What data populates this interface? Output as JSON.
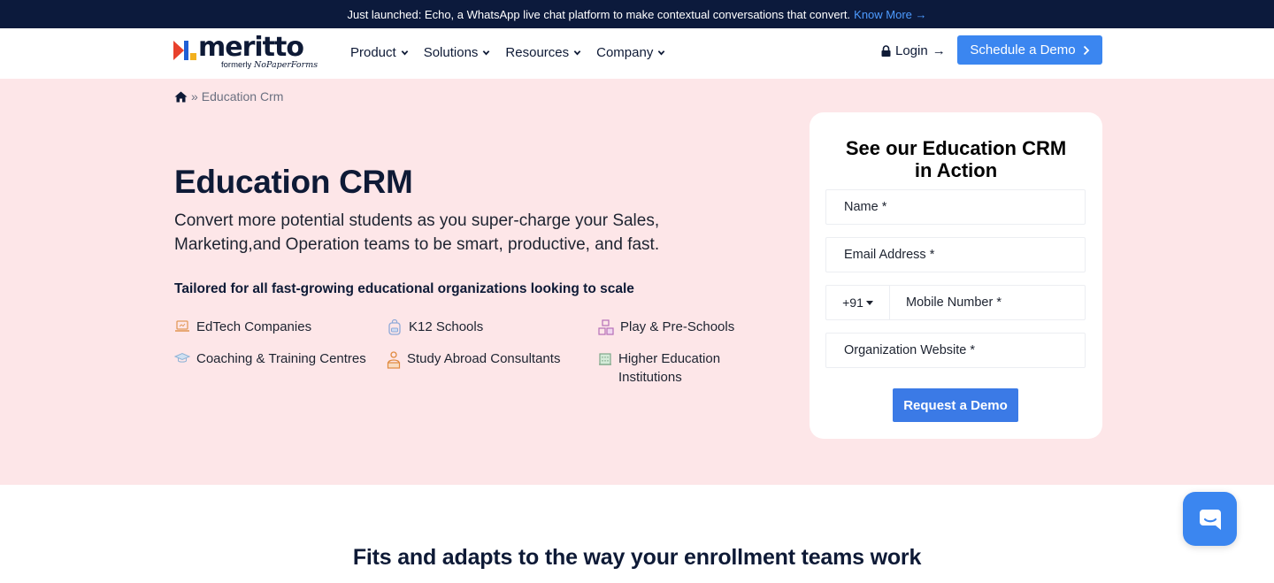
{
  "announcement": {
    "text": "Just launched: Echo, a WhatsApp live chat platform to make contextual conversations that convert.",
    "link_label": "Know More",
    "link_arrow": "→"
  },
  "header": {
    "logo_text": "meritto",
    "logo_sub_prefix": "formerly",
    "logo_sub_brand": "NoPaperForms",
    "nav": [
      {
        "label": "Product"
      },
      {
        "label": "Solutions"
      },
      {
        "label": "Resources"
      },
      {
        "label": "Company"
      }
    ],
    "login_label": "Login",
    "login_arrow": "→",
    "demo_label": "Schedule a Demo",
    "demo_arrow": "›"
  },
  "breadcrumb": {
    "separator": "»",
    "current": "Education Crm"
  },
  "hero": {
    "title": "Education CRM",
    "subtitle": "Convert more potential students as you super-charge your Sales, Marketing,and Operation teams to be smart, productive, and fast.",
    "tagline": "Tailored for all fast-growing educational organizations looking to scale",
    "segments": [
      {
        "label": "EdTech Companies",
        "icon": "laptop-icon"
      },
      {
        "label": "K12 Schools",
        "icon": "backpack-icon"
      },
      {
        "label": "Play & Pre-Schools",
        "icon": "blocks-icon"
      },
      {
        "label": "Coaching & Training Centres",
        "icon": "graduation-cap-icon"
      },
      {
        "label": "Study Abroad Consultants",
        "icon": "consultant-icon"
      },
      {
        "label": "Higher Education",
        "label2": "Institutions",
        "icon": "building-icon"
      }
    ]
  },
  "form": {
    "title": "See our Education CRM in Action",
    "name_placeholder": "Name *",
    "email_placeholder": "Email Address *",
    "country_code": "+91",
    "mobile_placeholder": "Mobile Number *",
    "website_placeholder": "Organization Website *",
    "submit_label": "Request a Demo"
  },
  "section": {
    "title": "Fits and adapts to the way your enrollment teams work"
  },
  "colors": {
    "announce_bg": "#0c1a3c",
    "hero_bg": "#fde6e8",
    "primary": "#3b86f0",
    "text_dark": "#0e1a36"
  }
}
